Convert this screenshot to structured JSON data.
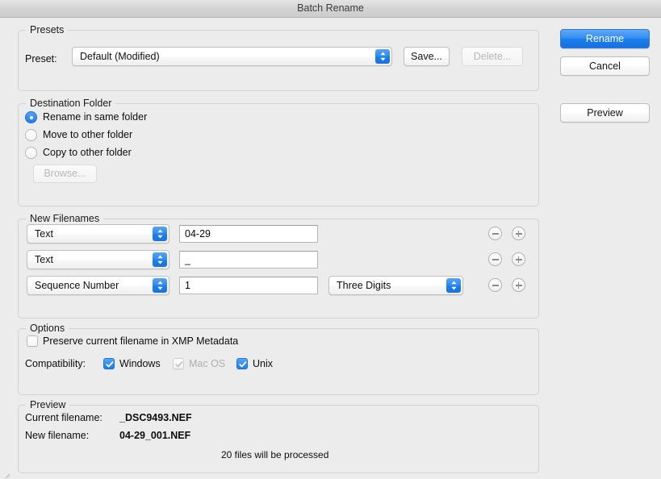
{
  "window": {
    "title": "Batch Rename"
  },
  "action_buttons": {
    "rename": "Rename",
    "cancel": "Cancel",
    "preview": "Preview"
  },
  "presets": {
    "group_title": "Presets",
    "preset_label": "Preset:",
    "preset_value": "Default (Modified)",
    "save_button": "Save...",
    "delete_button": "Delete..."
  },
  "destination": {
    "group_title": "Destination Folder",
    "options": [
      {
        "label": "Rename in same folder",
        "selected": true
      },
      {
        "label": "Move to other folder",
        "selected": false
      },
      {
        "label": "Copy to other folder",
        "selected": false
      }
    ],
    "browse_button": "Browse..."
  },
  "new_filenames": {
    "group_title": "New Filenames",
    "rows": [
      {
        "type": "Text",
        "value": "04-29",
        "format": null
      },
      {
        "type": "Text",
        "value": "_",
        "format": null
      },
      {
        "type": "Sequence Number",
        "value": "1",
        "format": "Three Digits"
      }
    ],
    "remove_icon": "minus-circle-icon",
    "add_icon": "plus-circle-icon"
  },
  "options": {
    "group_title": "Options",
    "preserve_label": "Preserve current filename in XMP Metadata",
    "preserve_checked": false,
    "compatibility_label": "Compatibility:",
    "compatibility": [
      {
        "label": "Windows",
        "checked": true,
        "disabled": false
      },
      {
        "label": "Mac OS",
        "checked": true,
        "disabled": true
      },
      {
        "label": "Unix",
        "checked": true,
        "disabled": false
      }
    ]
  },
  "preview": {
    "group_title": "Preview",
    "current_label": "Current filename:",
    "current_value": "_DSC9493.NEF",
    "new_label": "New filename:",
    "new_value": "04-29_001.NEF",
    "status": "20 files will be processed"
  },
  "colors": {
    "accent": "#1d7bea",
    "window_bg": "#ececec",
    "group_border": "#d2d2d2"
  }
}
